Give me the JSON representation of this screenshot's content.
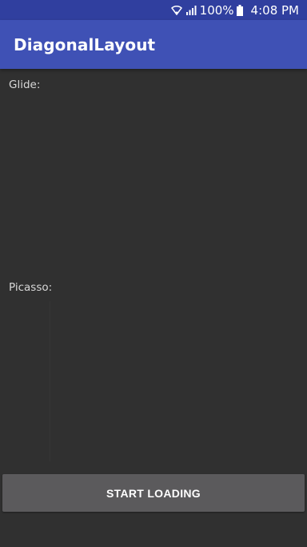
{
  "status_bar": {
    "battery": "100%",
    "time": "4:08 PM",
    "icons": [
      "wifi-icon",
      "signal-icon",
      "battery-icon"
    ]
  },
  "app_bar": {
    "title": "DiagonalLayout"
  },
  "sections": {
    "glide_label": "Glide:",
    "picasso_label": "Picasso:"
  },
  "button": {
    "label": "START LOADING"
  },
  "colors": {
    "status_bar": "#303f9f",
    "app_bar": "#3f51b5",
    "background": "#303030",
    "button": "#5b5a5c"
  }
}
